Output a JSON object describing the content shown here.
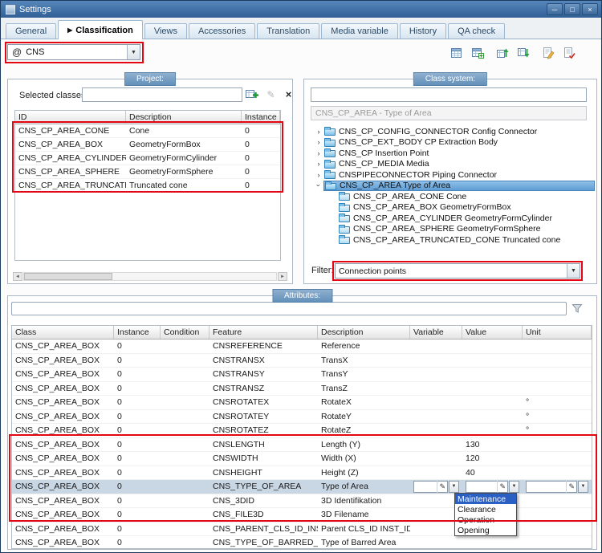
{
  "window": {
    "title": "Settings"
  },
  "icons": {
    "minimize": "─",
    "maximize": "□",
    "close": "×",
    "combo_arrow": "▼",
    "tree_chevron": "›",
    "pencil": "✎",
    "remove": "×",
    "scroll_left": "◄",
    "scroll_right": "►",
    "active_tab_arrow": "▶"
  },
  "tabs": [
    {
      "label": "General"
    },
    {
      "label": "Classification",
      "active": true
    },
    {
      "label": "Views"
    },
    {
      "label": "Accessories"
    },
    {
      "label": "Translation"
    },
    {
      "label": "Media variable"
    },
    {
      "label": "History"
    },
    {
      "label": "QA check"
    }
  ],
  "scheme_combo": {
    "prefix": "@",
    "value": "CNS"
  },
  "toolbar": {
    "icons": [
      "table-copy-icon",
      "table-paste-icon",
      "classes-upload-icon",
      "classes-download-icon",
      "report-edit-icon",
      "report-check-icon"
    ]
  },
  "project": {
    "group_label": "Project:",
    "selected_classes_label": "Selected classes",
    "selected_classes_value": "",
    "table": {
      "columns": [
        "ID",
        "Description",
        "Instance"
      ],
      "rows": [
        [
          "CNS_CP_AREA_CONE",
          "Cone",
          "0"
        ],
        [
          "CNS_CP_AREA_BOX",
          "GeometryFormBox",
          "0"
        ],
        [
          "CNS_CP_AREA_CYLINDER",
          "GeometryFormCylinder",
          "0"
        ],
        [
          "CNS_CP_AREA_SPHERE",
          "GeometryFormSphere",
          "0"
        ],
        [
          "CNS_CP_AREA_TRUNCATED_CONE",
          "Truncated cone",
          "0"
        ]
      ]
    }
  },
  "class_system": {
    "group_label": "Class system:",
    "search_value": "",
    "selected_class_label": "CNS_CP_AREA - Type of Area",
    "tree": [
      {
        "label": "CNS_CP_CONFIG_CONNECTOR Config Connector",
        "state": "collapsed",
        "level": 0
      },
      {
        "label": "CNS_CP_EXT_BODY CP Extraction Body",
        "state": "collapsed",
        "level": 0
      },
      {
        "label": "CNS_CP Insertion Point",
        "state": "collapsed",
        "level": 0
      },
      {
        "label": "CNS_CP_MEDIA Media",
        "state": "collapsed",
        "level": 0
      },
      {
        "label": "CNSPIPECONNECTOR Piping Connector",
        "state": "collapsed",
        "level": 0
      },
      {
        "label": "CNS_CP_AREA Type of Area",
        "state": "expanded",
        "level": 0,
        "selected": true
      },
      {
        "label": "CNS_CP_AREA_CONE Cone",
        "state": "leaf",
        "level": 1
      },
      {
        "label": "CNS_CP_AREA_BOX GeometryFormBox",
        "state": "leaf",
        "level": 1
      },
      {
        "label": "CNS_CP_AREA_CYLINDER GeometryFormCylinder",
        "state": "leaf",
        "level": 1
      },
      {
        "label": "CNS_CP_AREA_SPHERE GeometryFormSphere",
        "state": "leaf",
        "level": 1
      },
      {
        "label": "CNS_CP_AREA_TRUNCATED_CONE Truncated cone",
        "state": "leaf",
        "level": 1
      }
    ],
    "filter_label": "Filter:",
    "filter_value": "Connection points"
  },
  "attributes": {
    "group_label": "Attributes:",
    "search_value": "",
    "columns": [
      "Class",
      "Instance",
      "Condition",
      "Feature",
      "Description",
      "Variable",
      "Value",
      "Unit"
    ],
    "selected_row_index": 10,
    "rows": [
      {
        "class": "CNS_CP_AREA_BOX",
        "instance": "0",
        "condition": "",
        "feature": "CNSREFERENCE",
        "description": "Reference",
        "variable": "",
        "value": "",
        "unit": ""
      },
      {
        "class": "CNS_CP_AREA_BOX",
        "instance": "0",
        "condition": "",
        "feature": "CNSTRANSX",
        "description": "TransX",
        "variable": "",
        "value": "",
        "unit": ""
      },
      {
        "class": "CNS_CP_AREA_BOX",
        "instance": "0",
        "condition": "",
        "feature": "CNSTRANSY",
        "description": "TransY",
        "variable": "",
        "value": "",
        "unit": ""
      },
      {
        "class": "CNS_CP_AREA_BOX",
        "instance": "0",
        "condition": "",
        "feature": "CNSTRANSZ",
        "description": "TransZ",
        "variable": "",
        "value": "",
        "unit": ""
      },
      {
        "class": "CNS_CP_AREA_BOX",
        "instance": "0",
        "condition": "",
        "feature": "CNSROTATEX",
        "description": "RotateX",
        "variable": "",
        "value": "",
        "unit": "°"
      },
      {
        "class": "CNS_CP_AREA_BOX",
        "instance": "0",
        "condition": "",
        "feature": "CNSROTATEY",
        "description": "RotateY",
        "variable": "",
        "value": "",
        "unit": "°"
      },
      {
        "class": "CNS_CP_AREA_BOX",
        "instance": "0",
        "condition": "",
        "feature": "CNSROTATEZ",
        "description": "RotateZ",
        "variable": "",
        "value": "",
        "unit": "°"
      },
      {
        "class": "CNS_CP_AREA_BOX",
        "instance": "0",
        "condition": "",
        "feature": "CNSLENGTH",
        "description": "Length (Y)",
        "variable": "",
        "value": "130",
        "unit": ""
      },
      {
        "class": "CNS_CP_AREA_BOX",
        "instance": "0",
        "condition": "",
        "feature": "CNSWIDTH",
        "description": "Width (X)",
        "variable": "",
        "value": "120",
        "unit": ""
      },
      {
        "class": "CNS_CP_AREA_BOX",
        "instance": "0",
        "condition": "",
        "feature": "CNSHEIGHT",
        "description": "Height (Z)",
        "variable": "",
        "value": "40",
        "unit": ""
      },
      {
        "class": "CNS_CP_AREA_BOX",
        "instance": "0",
        "condition": "",
        "feature": "CNS_TYPE_OF_AREA",
        "description": "Type of Area",
        "variable": "",
        "value": "",
        "unit": ""
      },
      {
        "class": "CNS_CP_AREA_BOX",
        "instance": "0",
        "condition": "",
        "feature": "CNS_3DID",
        "description": "3D Identifikation",
        "variable": "",
        "value": "",
        "unit": ""
      },
      {
        "class": "CNS_CP_AREA_BOX",
        "instance": "0",
        "condition": "",
        "feature": "CNS_FILE3D",
        "description": "3D Filename",
        "variable": "",
        "value": "",
        "unit": ""
      },
      {
        "class": "CNS_CP_AREA_BOX",
        "instance": "0",
        "condition": "",
        "feature": "CNS_PARENT_CLS_ID_INST_ID",
        "description": "Parent CLS_ID INST_ID",
        "variable": "",
        "value": "",
        "unit": ""
      },
      {
        "class": "CNS_CP_AREA_BOX",
        "instance": "0",
        "condition": "",
        "feature": "CNS_TYPE_OF_BARRED_AREA",
        "description": "Type of Barred Area",
        "variable": "",
        "value": "",
        "unit": ""
      }
    ],
    "value_dropdown": {
      "options": [
        "Maintenance",
        "Clearance",
        "Operation",
        "Opening"
      ],
      "highlighted": "Maintenance"
    }
  }
}
